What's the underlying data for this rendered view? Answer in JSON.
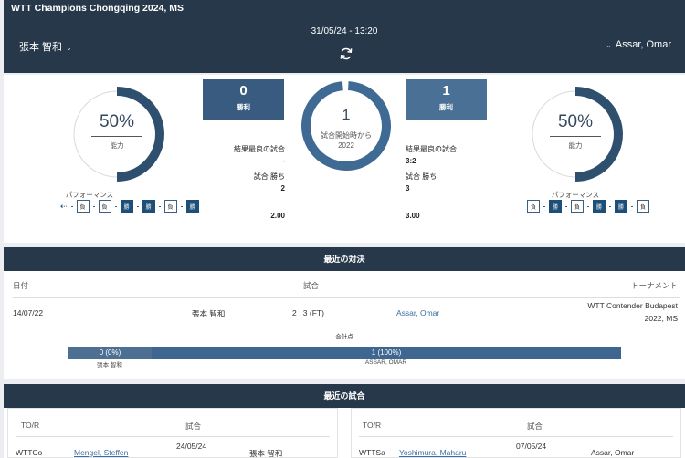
{
  "header": {
    "competition": "WTT Champions Chongqing 2024, MS",
    "datetime": "31/05/24 - 13:20",
    "player_left": "張本 智和",
    "player_right": "Assar, Omar",
    "refresh_icon": "refresh-icon"
  },
  "summary": {
    "left": {
      "ability_pct": "50%",
      "ability_value": 0.5,
      "ability_label": "能力",
      "performance_label": "パフォーマンス",
      "wins": "0",
      "wins_label": "勝利",
      "best_result_label": "結果最良の試合",
      "best_result_value": "-",
      "match_wins_label": "試合 勝ち",
      "match_wins_value": "2",
      "extra_value": "2.00",
      "form": [
        "負",
        "負",
        "勝",
        "勝",
        "負",
        "勝"
      ]
    },
    "center": {
      "count": "1",
      "label": "試合開始時から",
      "year": "2022"
    },
    "right": {
      "ability_pct": "50%",
      "ability_value": 0.5,
      "ability_label": "能力",
      "performance_label": "パフォーマンス",
      "wins": "1",
      "wins_label": "勝利",
      "best_result_label": "結果最良の試合",
      "best_result_value": "3:2",
      "match_wins_label": "試合 勝ち",
      "match_wins_value": "3",
      "extra_value": "3.00",
      "form": [
        "負",
        "勝",
        "負",
        "勝",
        "勝",
        "負"
      ]
    }
  },
  "h2h": {
    "title": "最近の対決",
    "col_date": "日付",
    "col_match": "試合",
    "col_tournament": "トーナメント",
    "row": {
      "date": "14/07/22",
      "player_left": "張本 智和",
      "score": "2 : 3 (FT)",
      "player_right": "Assar, Omar",
      "tournament_line1": "WTT Contender Budapest",
      "tournament_line2": "2022, MS"
    },
    "total_label": "合計点",
    "left_bar": "0 (0%)",
    "right_bar": "1 (100%)",
    "left_share": 0.15,
    "left_name": "張本 智和",
    "right_name": "ASSAR, OMAR"
  },
  "recent": {
    "title": "最近の試合",
    "left": {
      "col1": "TO/R",
      "col2": "試合",
      "tour": "WTTCo",
      "opponent": "Mengel, Steffen",
      "date": "24/05/24",
      "player": "張本 智和"
    },
    "right": {
      "col1": "TO/R",
      "col2": "試合",
      "tour": "WTTSa",
      "opponent": "Yoshimura, Maharu",
      "date": "07/05/24",
      "player": "Assar, Omar"
    }
  }
}
